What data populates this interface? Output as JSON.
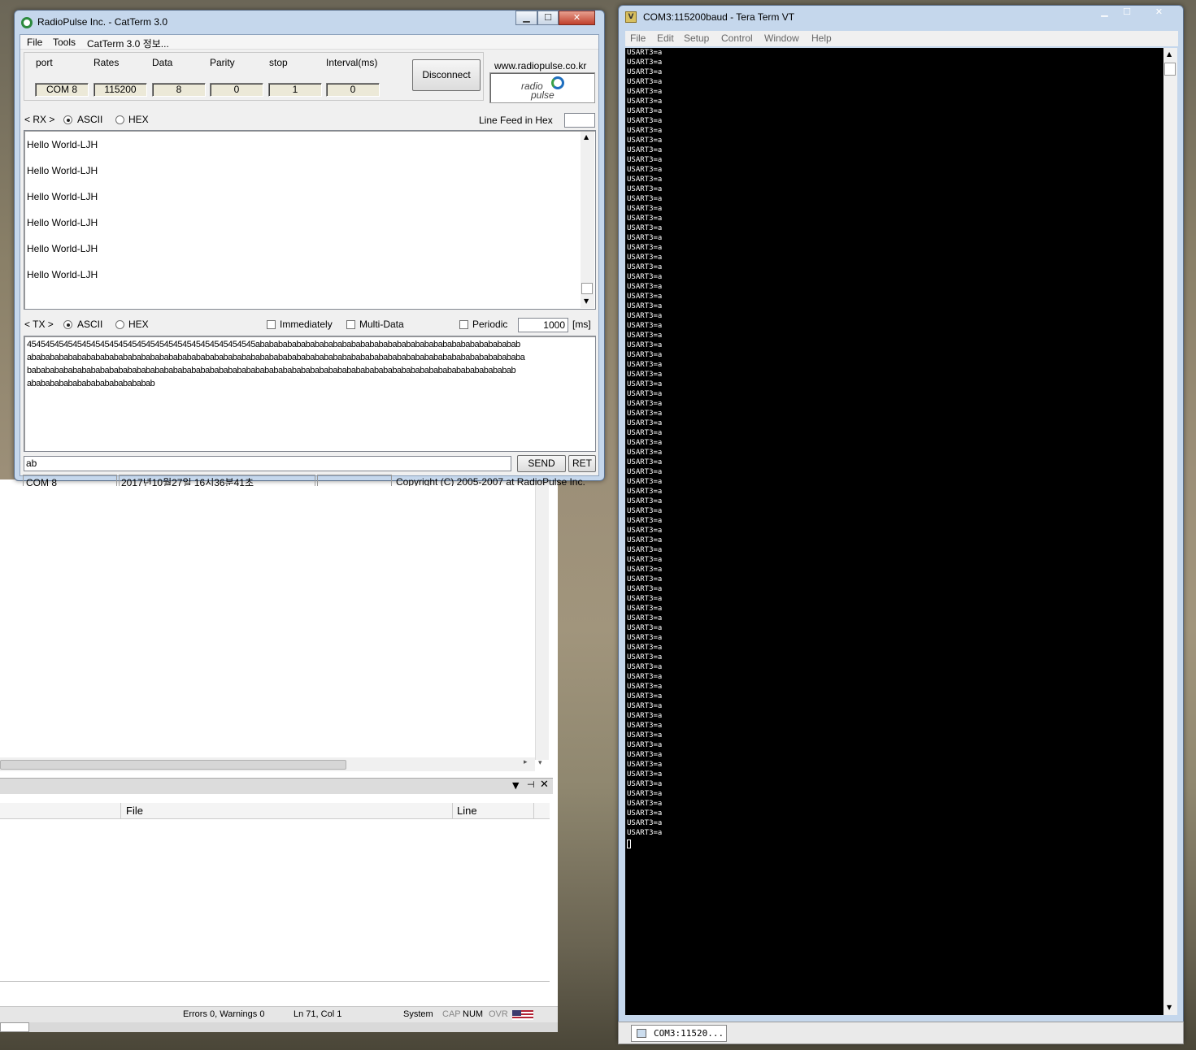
{
  "catterm": {
    "title": "RadioPulse Inc. - CatTerm 3.0",
    "menu": [
      "File",
      "Tools",
      "CatTerm 3.0 정보..."
    ],
    "conn_labels": {
      "port": "port",
      "rates": "Rates",
      "data": "Data",
      "parity": "Parity",
      "stop": "stop",
      "interval": "Interval(ms)"
    },
    "conn_values": {
      "port": "COM 8",
      "rates": "115200",
      "data": "8",
      "parity": "0",
      "stop": "1",
      "interval": "0"
    },
    "disconnect_label": "Disconnect",
    "website": "www.radiopulse.co.kr",
    "logo_text": [
      "radio",
      "pulse"
    ],
    "rx": {
      "label": "< RX >",
      "ascii": "ASCII",
      "hex": "HEX",
      "linefeed_label": "Line Feed in Hex",
      "linefeed_value": "",
      "lines": [
        "Hello World-LJH",
        "Hello World-LJH",
        "Hello World-LJH",
        "Hello World-LJH",
        "Hello World-LJH",
        "Hello World-LJH"
      ]
    },
    "tx": {
      "label": "< TX >",
      "ascii": "ASCII",
      "hex": "HEX",
      "immediately": "Immediately",
      "multidata": "Multi-Data",
      "periodic": "Periodic",
      "period_value": "1000",
      "period_unit": "[ms]",
      "lines": [
        "45454545454545454545454545454545454545454545454545ababababababababababababababababababababababababababababab",
        "ababababababababababababababababababababababababababababababababababababababababababababababababababababababa",
        "bababababababababababababababababababababababababababababababababababababababababababababababababababababab",
        "abababababababababababababab"
      ]
    },
    "send_input": "ab",
    "send_label": "SEND",
    "ret_label": "RET",
    "status": {
      "port": "COM 8",
      "datetime": "2017년10월27일 16시36분41초",
      "blank": "",
      "copyright": "Copyright (C) 2005-2007 at RadioPulse Inc."
    }
  },
  "ide": {
    "panel_columns": {
      "file": "File",
      "line": "Line"
    },
    "status": {
      "errors": "Errors 0, Warnings 0",
      "position": "Ln 71, Col 1",
      "system": "System",
      "cap": "CAP",
      "num": "NUM",
      "ovr": "OVR"
    }
  },
  "teraterm": {
    "title": "COM3:115200baud - Tera Term VT",
    "menu": [
      "File",
      "Edit",
      "Setup",
      "Control",
      "Window",
      "Help"
    ],
    "line_text": "USART3=a",
    "line_count": 81,
    "taskbar_item": "COM3:11520..."
  },
  "colors": {
    "terminal_bg": "#000000",
    "terminal_fg": "#ffffff",
    "window_frame": "#c5d7ec",
    "logo_blue": "#1f6fbf",
    "logo_green": "#3aa048"
  }
}
